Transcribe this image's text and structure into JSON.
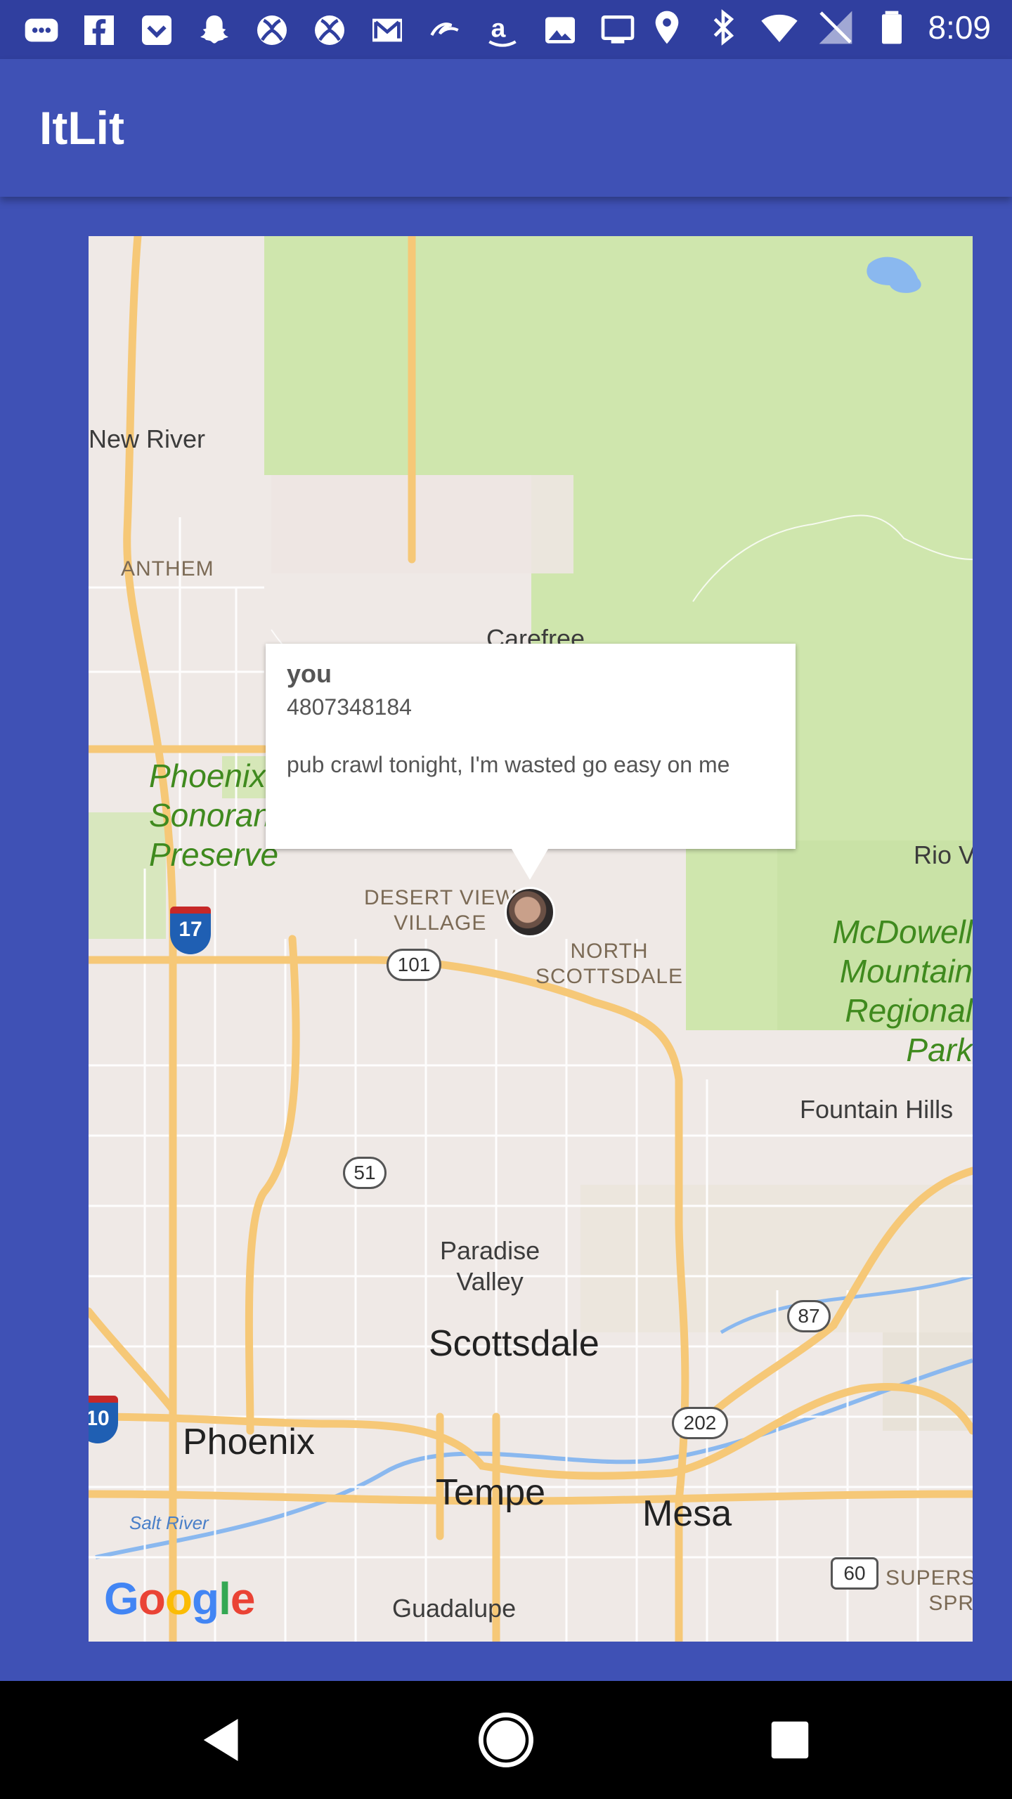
{
  "status_bar": {
    "time": "8:09",
    "left_icons": [
      "chat-bubble-icon",
      "facebook-icon",
      "pocket-icon",
      "snapchat-icon",
      "xbox-icon",
      "xbox-icon",
      "gmail-icon",
      "amazon-pay-icon",
      "amazon-icon",
      "photos-icon",
      "cast-icon"
    ],
    "right_icons": [
      "location-icon",
      "bluetooth-icon",
      "wifi-icon",
      "no-signal-icon",
      "battery-icon"
    ]
  },
  "app_bar": {
    "title": "ItLit"
  },
  "map": {
    "labels": {
      "new_river": "New River",
      "anthem": "ANTHEM",
      "carefree": "Carefree",
      "phoenix_sonoran": "Phoenix\nSonoran\nPreserve",
      "desert_view": "DESERT VIEW\nVILLAGE",
      "north_scottsdale": "NORTH\nSCOTTSDALE",
      "mcdowell": "McDowell\nMountain\nRegional Park",
      "rio_verde": "Rio V",
      "fountain_hills": "Fountain Hills",
      "paradise_valley": "Paradise\nValley",
      "scottsdale": "Scottsdale",
      "phoenix": "Phoenix",
      "tempe": "Tempe",
      "mesa": "Mesa",
      "salt_river": "Salt River",
      "guadalupe": "Guadalupe",
      "superstition": "SUPERSTI\nSPRIN"
    },
    "shields": {
      "i17": "17",
      "i10": "10",
      "sr101": "101",
      "sr51": "51",
      "sr87": "87",
      "sr202": "202",
      "us60": "60"
    },
    "attribution": "Google",
    "info_window": {
      "title": "you",
      "phone": "4807348184",
      "message": "pub crawl tonight, I'm wasted go easy on me"
    },
    "colors": {
      "land": "#efe9e6",
      "park": "#cfe6ad",
      "highway": "#f6c877",
      "water": "#8ab8ef"
    }
  },
  "nav_bar": {
    "back": "back-icon",
    "home": "home-icon",
    "recents": "recents-icon"
  }
}
